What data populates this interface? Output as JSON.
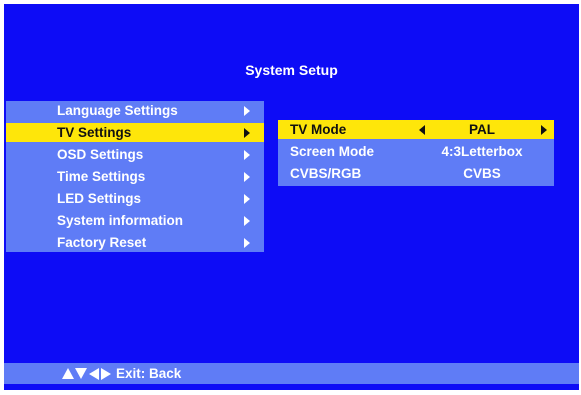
{
  "title": "System Setup",
  "menu": {
    "items": [
      {
        "label": "Language Settings",
        "selected": false
      },
      {
        "label": "TV Settings",
        "selected": true
      },
      {
        "label": "OSD Settings",
        "selected": false
      },
      {
        "label": "Time Settings",
        "selected": false
      },
      {
        "label": "LED Settings",
        "selected": false
      },
      {
        "label": "System information",
        "selected": false
      },
      {
        "label": "Factory Reset",
        "selected": false
      }
    ]
  },
  "settings": {
    "rows": [
      {
        "label": "TV Mode",
        "value": "PAL",
        "selected": true
      },
      {
        "label": "Screen Mode",
        "value": "4:3Letterbox",
        "selected": false
      },
      {
        "label": "CVBS/RGB",
        "value": "CVBS",
        "selected": false
      }
    ]
  },
  "footer": {
    "nav_icons": [
      "up-arrow",
      "down-arrow",
      "left-arrow",
      "right-arrow"
    ],
    "exit_label": "Exit: Back"
  },
  "colors": {
    "background": "#0d0cf6",
    "panel": "#5f7cf6",
    "highlight": "#fee60a",
    "text": "#ffffff",
    "highlight_text": "#111111"
  }
}
